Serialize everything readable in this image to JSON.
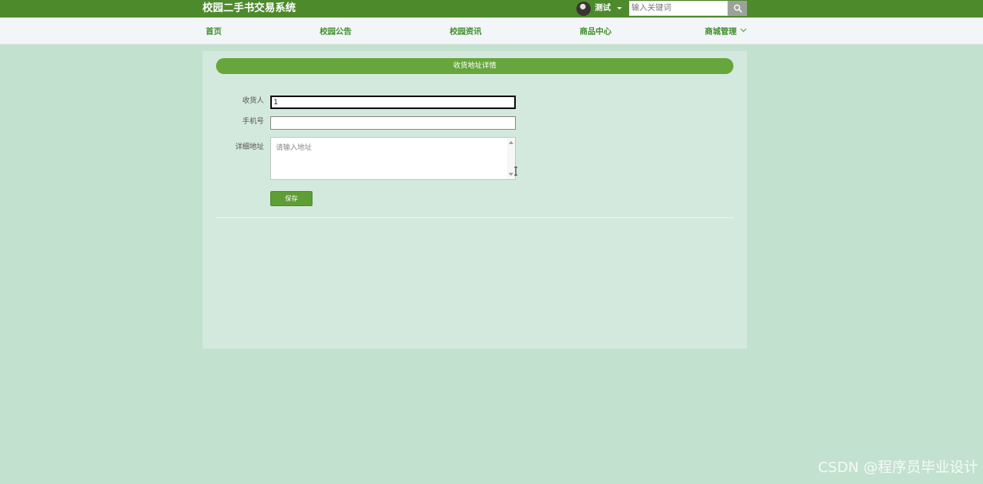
{
  "header": {
    "site_title": "校园二手书交易系统",
    "username": "测试",
    "search": {
      "placeholder": "输入关键词",
      "value": ""
    },
    "icons": {
      "avatar": "user-avatar",
      "dropdown": "caret-down-icon",
      "search": "search-icon"
    }
  },
  "nav": {
    "items": [
      {
        "label": "首页"
      },
      {
        "label": "校园公告"
      },
      {
        "label": "校园资讯"
      },
      {
        "label": "商品中心"
      },
      {
        "label": "商城管理"
      }
    ],
    "dropdown_icon": "chevron-down-icon"
  },
  "form": {
    "title": "收货地址详情",
    "fields": {
      "recipient": {
        "label": "收货人",
        "value": "1"
      },
      "phone": {
        "label": "手机号",
        "value": ""
      },
      "address": {
        "label": "详细地址",
        "placeholder": "请输入地址",
        "value": ""
      }
    },
    "save_label": "保存"
  },
  "watermark": "CSDN @程序员毕业设计",
  "colors": {
    "page_background": "#c2e1cf",
    "topbar": "#4d8a2c",
    "panel": "#d4e9dd",
    "accent": "#67a63c",
    "nav_text": "#3f8d2b"
  }
}
